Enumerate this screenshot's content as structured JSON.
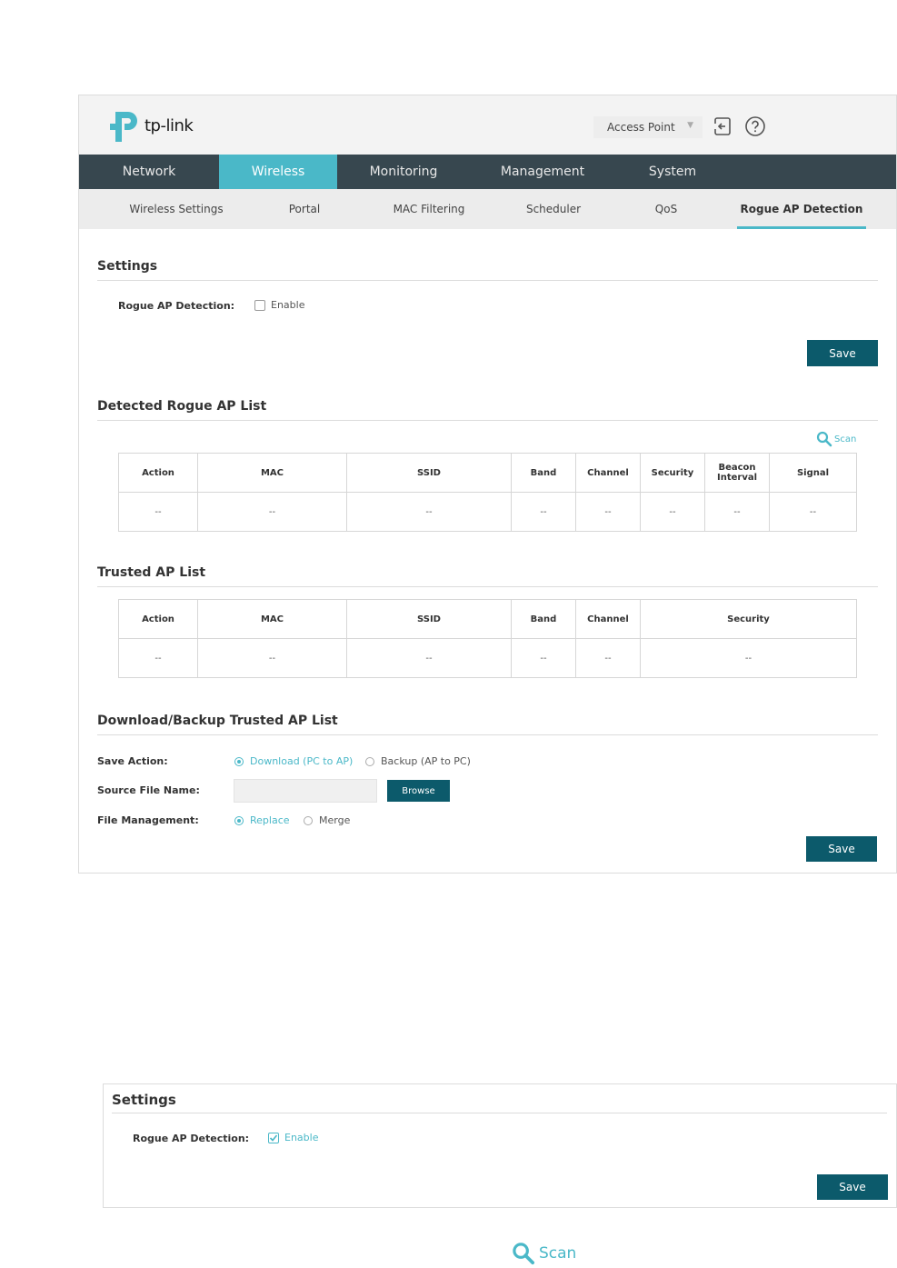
{
  "header": {
    "brand": "tp-link",
    "mode_label": "Access Point"
  },
  "main_nav": [
    "Network",
    "Wireless",
    "Monitoring",
    "Management",
    "System"
  ],
  "sub_nav": [
    "Wireless Settings",
    "Portal",
    "MAC Filtering",
    "Scheduler",
    "QoS",
    "Rogue AP Detection"
  ],
  "settings": {
    "title": "Settings",
    "label": "Rogue AP Detection:",
    "enable_label": "Enable",
    "enabled": false,
    "save_label": "Save"
  },
  "detected": {
    "title": "Detected Rogue AP List",
    "scan_label": "Scan",
    "columns": [
      "Action",
      "MAC",
      "SSID",
      "Band",
      "Channel",
      "Security",
      "Beacon Interval",
      "Signal"
    ],
    "row": [
      "--",
      "--",
      "--",
      "--",
      "--",
      "--",
      "--",
      "--"
    ]
  },
  "trusted": {
    "title": "Trusted AP List",
    "columns": [
      "Action",
      "MAC",
      "SSID",
      "Band",
      "Channel",
      "Security"
    ],
    "row": [
      "--",
      "--",
      "--",
      "--",
      "--",
      "--"
    ]
  },
  "backup": {
    "title": "Download/Backup Trusted AP List",
    "save_action_label": "Save Action:",
    "download_option": "Download (PC to AP)",
    "backup_option": "Backup (AP to PC)",
    "source_label": "Source File Name:",
    "source_value": "",
    "browse_label": "Browse",
    "file_mgmt_label": "File Management:",
    "replace_option": "Replace",
    "merge_option": "Merge",
    "save_label": "Save"
  },
  "settings2": {
    "title": "Settings",
    "label": "Rogue AP Detection:",
    "enable_label": "Enable",
    "enabled": true,
    "save_label": "Save"
  },
  "scan_button": {
    "label": "Scan"
  },
  "colors": {
    "accent": "#4ab8c8",
    "nav_bg": "#37474f",
    "button": "#0c5a6b"
  }
}
